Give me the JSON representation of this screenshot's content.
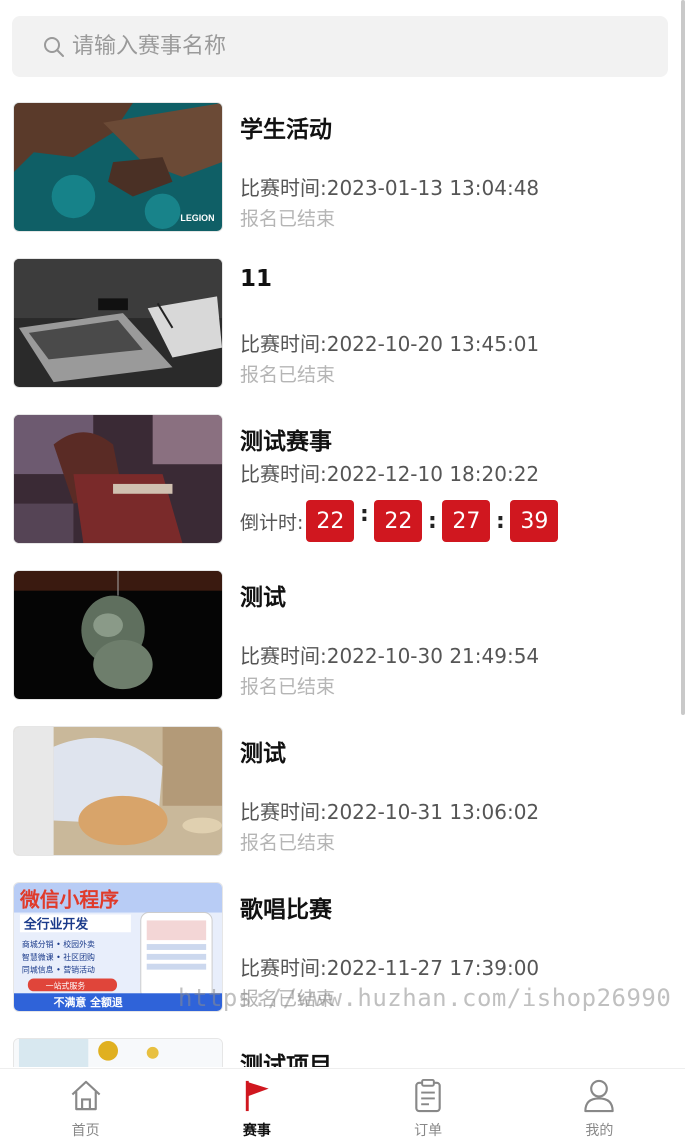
{
  "search": {
    "placeholder": "请输入赛事名称"
  },
  "events": [
    {
      "title": "学生活动",
      "time": "比赛时间:2023-01-13 13:04:48",
      "status": "报名已结束"
    },
    {
      "title": "11",
      "time": "比赛时间:2022-10-20 13:45:01",
      "status": "报名已结束"
    },
    {
      "title": "测试赛事",
      "time": "比赛时间:2022-12-10 18:20:22",
      "countdown_label": "倒计时:",
      "countdown": [
        "22",
        "22",
        "27",
        "39"
      ]
    },
    {
      "title": "测试",
      "time": "比赛时间:2022-10-30 21:49:54",
      "status": "报名已结束"
    },
    {
      "title": "测试",
      "time": "比赛时间:2022-10-31 13:06:02",
      "status": "报名已结束"
    },
    {
      "title": "歌唱比赛",
      "time": "比赛时间:2022-11-27 17:39:00",
      "status": "报名已结束"
    },
    {
      "title": "测试项目"
    }
  ],
  "thumb_text": {
    "legion": "LEGION",
    "ad_title": "微信小程序",
    "ad_sub": "全行业开发",
    "ad_lines": [
      "商城分销 • 校园外卖",
      "智慧微课 • 社区团购",
      "同城信息 • 营销活动"
    ],
    "ad_btn": "一站式服务",
    "ad_bottom": "不满意  全额退"
  },
  "watermark": "https://www.huzhan.com/ishop26990",
  "tabbar": [
    {
      "label": "首页",
      "icon": "home-icon"
    },
    {
      "label": "赛事",
      "icon": "flag-icon",
      "active": true
    },
    {
      "label": "订单",
      "icon": "clipboard-icon"
    },
    {
      "label": "我的",
      "icon": "user-icon"
    }
  ],
  "colors": {
    "accent": "#d0171f",
    "muted": "#b5b5b5",
    "search_bg": "#f2f2f2"
  }
}
